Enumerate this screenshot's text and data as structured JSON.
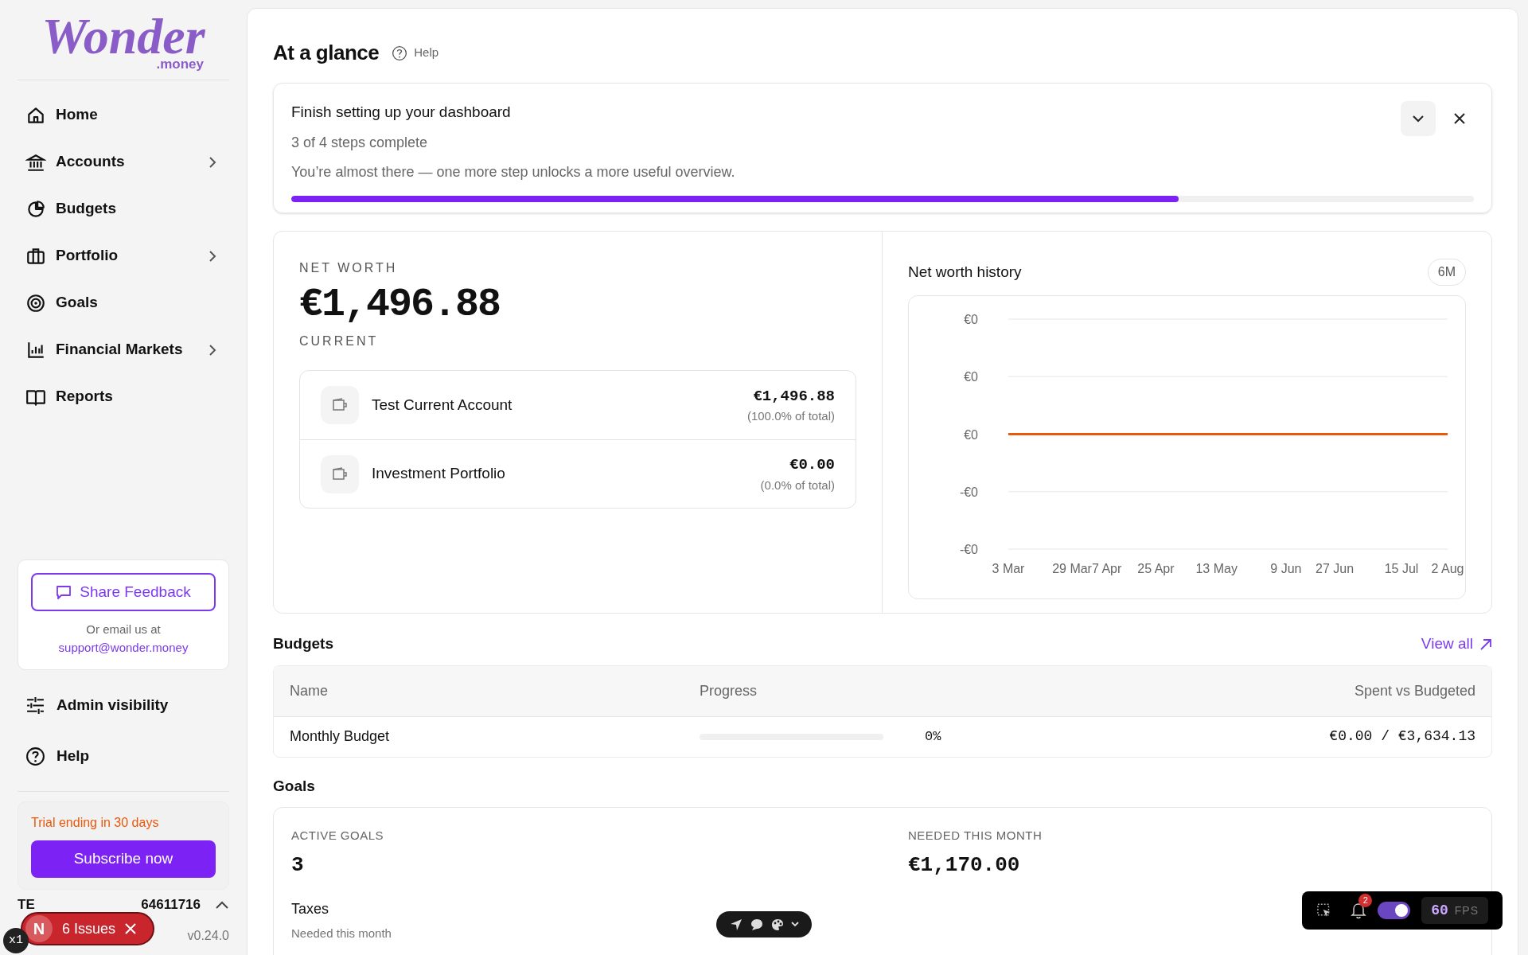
{
  "sidebar": {
    "logo": {
      "wordmark": "Wonder",
      "suffix": ".money"
    },
    "nav": [
      {
        "label": "Home",
        "has_submenu": false
      },
      {
        "label": "Accounts",
        "has_submenu": true
      },
      {
        "label": "Budgets",
        "has_submenu": false
      },
      {
        "label": "Portfolio",
        "has_submenu": true
      },
      {
        "label": "Goals",
        "has_submenu": false
      },
      {
        "label": "Financial Markets",
        "has_submenu": true
      },
      {
        "label": "Reports",
        "has_submenu": false
      }
    ],
    "feedback": {
      "button": "Share Feedback",
      "note": "Or email us at",
      "email": "support@wonder.money"
    },
    "footer_links": [
      {
        "label": "Admin visibility"
      },
      {
        "label": "Help"
      }
    ],
    "trial": {
      "notice": "Trial ending in 30 days",
      "button": "Subscribe now"
    },
    "user": {
      "text_start": "TE",
      "text_end": "64611716"
    },
    "version": "v0.24.0"
  },
  "page": {
    "title": "At a glance",
    "help": "Help"
  },
  "setup": {
    "title": "Finish setting up your dashboard",
    "steps": "3 of 4 steps complete",
    "message": "You’re almost there — one more step unlocks a more useful overview.",
    "level": 0.75
  },
  "net_worth": {
    "label": "NET WORTH",
    "amount": "€1,496.88",
    "sublabel": "CURRENT",
    "accounts": [
      {
        "name": "Test Current Account",
        "amount": "€1,496.88",
        "share": "(100.0% of total)"
      },
      {
        "name": "Investment Portfolio",
        "amount": "€0.00",
        "share": "(0.0% of total)"
      }
    ]
  },
  "history": {
    "title": "Net worth history",
    "range": "6M",
    "y_labels": [
      "€0",
      "€0",
      "€0",
      "-€0",
      "-€0"
    ],
    "x_labels": [
      "3 Mar",
      "29 Mar",
      "7 Apr",
      "25 Apr",
      "13 May",
      "9 Jun",
      "27 Jun",
      "15 Jul",
      "2 Aug"
    ]
  },
  "budgets": {
    "title": "Budgets",
    "view_all": "View all",
    "columns": [
      "Name",
      "Progress",
      "Spent vs Budgeted"
    ],
    "rows": [
      {
        "name": "Monthly Budget",
        "level": 0,
        "percent": "0%",
        "amount": "€0.00 / €3,634.13"
      }
    ]
  },
  "goals": {
    "title": "Goals",
    "stats": [
      {
        "label": "ACTIVE GOALS",
        "value": "3"
      },
      {
        "label": "NEEDED THIS MONTH",
        "value": "€1,170.00"
      }
    ],
    "items": [
      {
        "name": "Taxes",
        "note": "Needed this month"
      }
    ]
  },
  "dev_overlay": {
    "badge_letter": "N",
    "issues": "6 Issues",
    "zoom": "x1",
    "notifications": "2",
    "toggle_on": true,
    "fps": "60",
    "fps_unit": "FPS"
  }
}
